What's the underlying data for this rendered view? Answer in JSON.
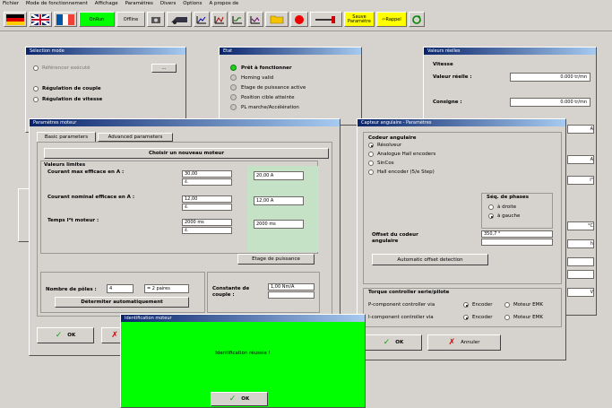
{
  "menu": [
    "Fichier",
    "Mode de fonctionnement",
    "Affichage",
    "Paramètres",
    "Divers",
    "Options",
    "A propos de"
  ],
  "toolbar": {
    "online": "OnRun",
    "offline": "Offline",
    "save_params": "Sauve Paramètre",
    "recall": "Rappel",
    "accent": "#00ff00",
    "yellow": "#ffff00"
  },
  "win_mode": {
    "title": "Sélection mode",
    "checkbox": "Référencer exécuté",
    "options": [
      "Régulation de couple",
      "Régulation de vitesse"
    ]
  },
  "win_status": {
    "title": "Etat",
    "items": [
      "Prêt à fonctionner",
      "Homing valid",
      "Etage de puissance active",
      "Position cible atteinte",
      "PL marche/Accélération"
    ]
  },
  "win_speed": {
    "title": "Valeurs réelles",
    "vitesse": "Vitesse",
    "valeur_reelle": "Valeur réelle :",
    "value1": "0.000 tr/mn",
    "consigne": "Consigne :",
    "value2": "0.000 tr/mn",
    "right_vals": [
      "A",
      "A",
      "I\"",
      "°C",
      "h",
      "V"
    ]
  },
  "win_motor": {
    "title": "Paramètres moteur",
    "tabs": [
      "Basic parameters",
      "Advanced parameters"
    ],
    "choose_btn": "Choisir un nouveau moteur",
    "group_title": "Valeurs limites",
    "rms": "Courant max efficace en A :",
    "rms_val": "30,00",
    "rms_spin": "4.",
    "rms_out": "20,00 A",
    "nom": "Courant nominal efficace en A :",
    "nom_val": "12,00",
    "nom_spin": "4.",
    "nom_out": "12,00 A",
    "pt": "Temps I²t moteur :",
    "pt_val": "2000 ms",
    "pt_spin": "4.",
    "pt_out": "2000 ms",
    "power_btn": "Etage de puissance",
    "poles": "Nombre de pôles :",
    "poles_val": "4",
    "paires": "= 2 paires",
    "auto_btn": "Détermiter automatiquement",
    "constante": "Constante de couple :",
    "const_val": "1,00 Nm/A",
    "ok": "OK",
    "cancel": "Annuler"
  },
  "win_angle": {
    "title": "Capteur angulaire - Paramètres",
    "group_title": "Codeur angulaire",
    "options": [
      "Résolveur",
      "Analogue Hall encoders",
      "SinCos",
      "Hall encoder (5/e Step)"
    ],
    "phase_title": "Séq. de phases",
    "phase_opts": [
      "à droite",
      "à gauche"
    ],
    "offset": "Offset du codeur angulaire",
    "offset_val": "350,7 °",
    "auto_btn": "Automatic offset detection",
    "torque_title": "Torque controller serie/pilote",
    "row1": "P-component controller via",
    "row2": "I-component controller via",
    "encoder": "Encoder",
    "emk": "Moteur EMK",
    "ok": "OK",
    "cancel": "Annuler"
  },
  "dialog": {
    "title": "Identification moteur",
    "message": "Identification réussie !",
    "ok": "OK",
    "bg": "#00ff00"
  }
}
